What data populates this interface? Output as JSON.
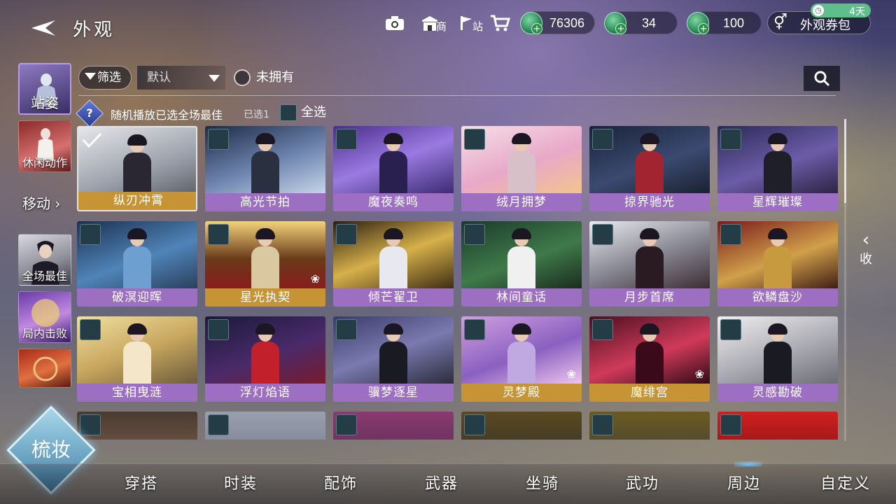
{
  "header": {
    "title": "外观",
    "icons": [
      {
        "name": "camera-icon",
        "glyph": "📷",
        "mini": ""
      },
      {
        "name": "shop-icon",
        "glyph": "🏬",
        "mini": "商"
      },
      {
        "name": "station-icon",
        "glyph": "⚑",
        "mini": "站"
      },
      {
        "name": "cart-icon",
        "glyph": "🛒",
        "mini": ""
      }
    ],
    "currencies": [
      {
        "name": "jade-currency",
        "amount": "76306"
      },
      {
        "name": "token-currency",
        "amount": "34"
      },
      {
        "name": "ticket-currency",
        "amount": "100"
      }
    ],
    "pack_label": "外观券包",
    "days_badge": "4天"
  },
  "sidebar": {
    "items": [
      {
        "label": "站姿",
        "active": true
      },
      {
        "label": "休闲动作",
        "active": false
      },
      {
        "label": "移动",
        "active": false
      },
      {
        "label": "全场最佳",
        "active": false
      },
      {
        "label": "局内击败",
        "active": false
      },
      {
        "label": "",
        "active": false
      }
    ],
    "move_label": "移动"
  },
  "filter": {
    "filter_label": "筛选",
    "sort_value": "默认",
    "owned_label": "未拥有"
  },
  "random": {
    "text": "随机播放已选全场最佳",
    "count": "已选1",
    "select_all": "全选"
  },
  "cards": [
    {
      "name": "纵刃冲霄",
      "style": "gold",
      "selected": true,
      "paw": false,
      "bg": "linear-gradient(160deg,#e6e6ea,#9aa0aa 60%,#5b5e66)",
      "body": "#2a2632"
    },
    {
      "name": "高光节拍",
      "style": "purple",
      "selected": false,
      "paw": false,
      "bg": "linear-gradient(160deg,#1c2a46,#6f86b0 55%,#c8d6ea)",
      "body": "#2a3040"
    },
    {
      "name": "魔夜奏鸣",
      "style": "purple",
      "selected": false,
      "paw": false,
      "bg": "linear-gradient(160deg,#4b2d8c,#9a7ae0 50%,#3a2a70)",
      "body": "#2a2050"
    },
    {
      "name": "绒月拥梦",
      "style": "purple",
      "selected": false,
      "paw": false,
      "bg": "linear-gradient(160deg,#f5dfe6,#e8a8c8 55%,#f2c58a)",
      "body": "#d7c0c8"
    },
    {
      "name": "掠界驰光",
      "style": "purple",
      "selected": false,
      "paw": false,
      "bg": "linear-gradient(160deg,#1a2238,#3a4a70 55%,#1a1f2e)",
      "body": "#a22430"
    },
    {
      "name": "星辉璀璨",
      "style": "purple",
      "selected": false,
      "paw": false,
      "bg": "linear-gradient(160deg,#2a2a55,#6c5ca8 55%,#2a2240)",
      "body": "#1f1f2a"
    },
    {
      "name": "破溟迎晖",
      "style": "purple",
      "selected": false,
      "paw": false,
      "bg": "linear-gradient(160deg,#1c3050,#4f84b8 55%,#2a3d5a)",
      "body": "#6da0d0"
    },
    {
      "name": "星光执契",
      "style": "gold",
      "selected": false,
      "paw": true,
      "bg": "linear-gradient(180deg,#f2d37a,#6a3a1a 55%,#8a1c1c)",
      "body": "#d9c8a0"
    },
    {
      "name": "倾芒翟卫",
      "style": "purple",
      "selected": false,
      "paw": false,
      "bg": "linear-gradient(160deg,#2a1e10,#d6b04a 50%,#3a2a12)",
      "body": "#e8e8f0"
    },
    {
      "name": "林间童话",
      "style": "purple",
      "selected": false,
      "paw": false,
      "bg": "linear-gradient(160deg,#1a3a2a,#3f7a4a 55%,#1a2a1e)",
      "body": "#f0f0f0"
    },
    {
      "name": "月步首席",
      "style": "purple",
      "selected": false,
      "paw": false,
      "bg": "linear-gradient(160deg,#eaeaf0,#8a8a96 50%,#3a2a30)",
      "body": "#2a1a22"
    },
    {
      "name": "欲鳞盘沙",
      "style": "purple",
      "selected": false,
      "paw": false,
      "bg": "linear-gradient(160deg,#7a1a1a,#d0a04a 55%,#3a1a12)",
      "body": "#c89a40"
    },
    {
      "name": "宝相曳涟",
      "style": "purple",
      "selected": false,
      "paw": false,
      "bg": "linear-gradient(160deg,#f0e0a0,#c9a860 50%,#6a5a3a)",
      "body": "#f4e6c8"
    },
    {
      "name": "浮灯焰语",
      "style": "purple",
      "selected": false,
      "paw": false,
      "bg": "linear-gradient(160deg,#1a1a3a,#4a2a6a 55%,#7a1a2a)",
      "body": "#c2202a"
    },
    {
      "name": "骥梦逐星",
      "style": "purple",
      "selected": false,
      "paw": false,
      "bg": "linear-gradient(160deg,#3a3a6a,#7a7ab0 50%,#2a2a3a)",
      "body": "#1a1a22"
    },
    {
      "name": "灵梦殿",
      "style": "gold",
      "selected": false,
      "paw": true,
      "bg": "linear-gradient(160deg,#d0a0e0,#8a60c0 55%,#f0c8f0)",
      "body": "#c0a8e0"
    },
    {
      "name": "魔绯宫",
      "style": "gold",
      "selected": false,
      "paw": true,
      "bg": "linear-gradient(160deg,#4a1020,#d03a5a 55%,#2a0a14)",
      "body": "#3a0a1a"
    },
    {
      "name": "灵感勘破",
      "style": "purple",
      "selected": false,
      "paw": false,
      "bg": "linear-gradient(160deg,#f0f0f0,#b0b0b8 50%,#6a6a72)",
      "body": "#1a1a22"
    },
    {
      "name": "",
      "style": "purple",
      "selected": false,
      "paw": false,
      "bg": "linear-gradient(180deg,#4a3a30,#8a6a50)",
      "body": "transparent"
    },
    {
      "name": "",
      "style": "purple",
      "selected": false,
      "paw": false,
      "bg": "linear-gradient(180deg,#9aa0b0,#6a7080)",
      "body": "transparent"
    },
    {
      "name": "",
      "style": "purple",
      "selected": false,
      "paw": false,
      "bg": "linear-gradient(180deg,#8a3a70,#4a2a50)",
      "body": "transparent"
    },
    {
      "name": "",
      "style": "purple",
      "selected": false,
      "paw": false,
      "bg": "linear-gradient(180deg,#5a4a20,#2a2a30)",
      "body": "transparent"
    },
    {
      "name": "",
      "style": "purple",
      "selected": false,
      "paw": false,
      "bg": "linear-gradient(180deg,#6a5a20,#3a3a40)",
      "body": "transparent"
    },
    {
      "name": "",
      "style": "purple",
      "selected": false,
      "paw": false,
      "bg": "linear-gradient(180deg,#d02020,#6a1010)",
      "body": "transparent"
    }
  ],
  "collapse_label": "收",
  "makeup_label": "梳妆",
  "tabs": [
    {
      "label": "穿搭",
      "active": false
    },
    {
      "label": "时装",
      "active": false
    },
    {
      "label": "配饰",
      "active": false
    },
    {
      "label": "武器",
      "active": false
    },
    {
      "label": "坐骑",
      "active": false
    },
    {
      "label": "武功",
      "active": false
    },
    {
      "label": "周边",
      "active": true
    },
    {
      "label": "自定义",
      "active": false
    }
  ],
  "colors": {
    "accent_purple": "#9c6fc2",
    "accent_gold": "#c69434",
    "active_sidebar": "#b79be6"
  }
}
